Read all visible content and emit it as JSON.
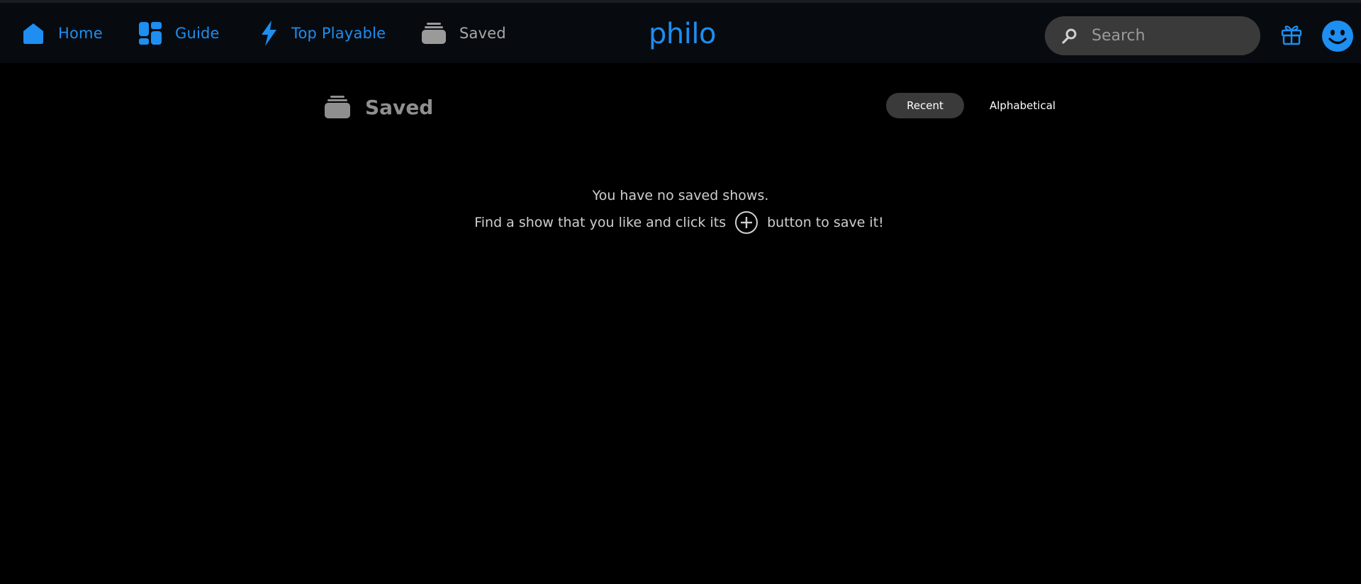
{
  "colors": {
    "accent": "#1e8ef0",
    "muted": "#8f8f8f",
    "background": "#000000",
    "topbar": "#070b10"
  },
  "nav": {
    "items": [
      {
        "label": "Home",
        "icon": "home-icon",
        "color": "#1e8ef0"
      },
      {
        "label": "Guide",
        "icon": "guide-icon",
        "color": "#1e8ef0"
      },
      {
        "label": "Top Playable",
        "icon": "lightning-icon",
        "color": "#1e8ef0"
      },
      {
        "label": "Saved",
        "icon": "saved-stack-icon",
        "color": "#9a9a9a"
      }
    ]
  },
  "logo": {
    "text": "philo"
  },
  "search": {
    "placeholder": "Search",
    "icon": "search-icon"
  },
  "header_icons": {
    "gift": "gift-icon",
    "profile": "smiley-avatar-icon"
  },
  "page": {
    "title": "Saved",
    "icon": "saved-stack-icon",
    "sort": {
      "options": [
        "Recent",
        "Alphabetical"
      ],
      "selected": "Recent"
    },
    "empty_state": {
      "line1": "You have no saved shows.",
      "line2_before": "Find a show that you like and click its",
      "line2_after": "button to save it!",
      "inline_icon": "plus-circle-icon"
    }
  }
}
